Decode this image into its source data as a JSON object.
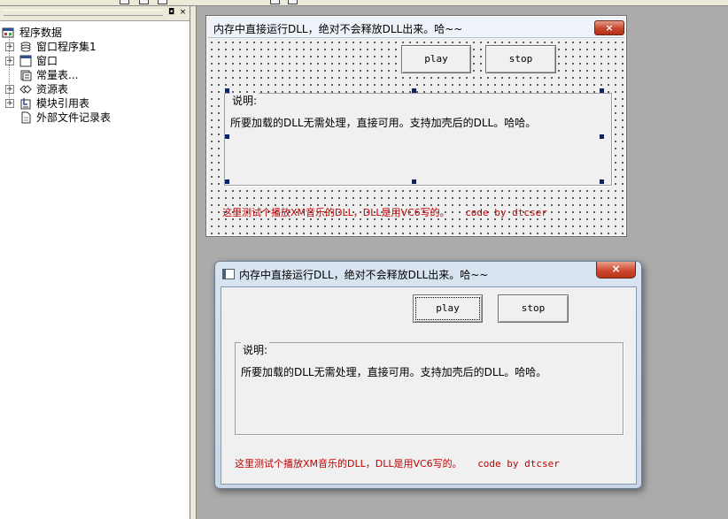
{
  "tree": {
    "root_label": "程序数据",
    "items": [
      {
        "label": "窗口程序集1",
        "icon": "assembly-icon",
        "expandable": true
      },
      {
        "label": "窗口",
        "icon": "window-icon",
        "expandable": true
      },
      {
        "label": "常量表...",
        "icon": "constants-icon",
        "expandable": false
      },
      {
        "label": "资源表",
        "icon": "resources-icon",
        "expandable": true
      },
      {
        "label": "模块引用表",
        "icon": "module-icon",
        "expandable": true
      },
      {
        "label": "外部文件记录表",
        "icon": "file-icon",
        "expandable": false
      }
    ]
  },
  "panel": {
    "pin_glyph": "◘",
    "close_glyph": "×"
  },
  "form": {
    "title": "内存中直接运行DLL，绝对不会释放DLL出来。哈~~",
    "close_glyph": "×",
    "play_label": "play",
    "stop_label": "stop",
    "group_label": "说明:",
    "description": "所要加载的DLL无需处理，直接可用。支持加壳后的DLL。哈哈。",
    "note": "这里测试个播放XM音乐的DLL，DLL是用VC6写的。",
    "credit": "code by dtcser"
  },
  "colors": {
    "note_red": "#c00000",
    "selection_handle": "#0a246a"
  }
}
